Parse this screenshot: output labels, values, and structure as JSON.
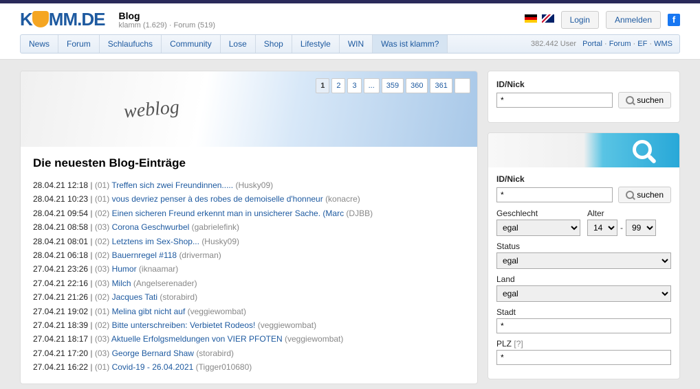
{
  "header": {
    "title": "Blog",
    "sub_site": "klamm",
    "sub_site_count": "(1.629)",
    "sub_forum": "Forum",
    "sub_forum_count": "(519)",
    "login": "Login",
    "signup": "Anmelden"
  },
  "nav": {
    "items": [
      "News",
      "Forum",
      "Schlaufuchs",
      "Community",
      "Lose",
      "Shop",
      "Lifestyle",
      "WIN",
      "Was ist klamm?"
    ],
    "active": 8,
    "usercount": "382.442 User",
    "links": [
      "Portal",
      "Forum",
      "EF",
      "WMS"
    ]
  },
  "pagination": [
    "1",
    "2",
    "3",
    "...",
    "359",
    "360",
    "361"
  ],
  "blog": {
    "heading": "Die neuesten Blog-Einträge",
    "entries": [
      {
        "ts": "28.04.21 12:18",
        "cnt": "(01)",
        "title": "Treffen sich zwei Freundinnen.....",
        "author": "(Husky09)"
      },
      {
        "ts": "28.04.21 10:23",
        "cnt": "(01)",
        "title": "vous devriez penser à des robes de demoiselle d'honneur",
        "author": "(konacre)"
      },
      {
        "ts": "28.04.21 09:54",
        "cnt": "(02)",
        "title": "Einen sicheren Freund erkennt man in unsicherer Sache. (Marc",
        "author": "(DJBB)"
      },
      {
        "ts": "28.04.21 08:58",
        "cnt": "(03)",
        "title": "Corona Geschwurbel",
        "author": "(gabrielefink)"
      },
      {
        "ts": "28.04.21 08:01",
        "cnt": "(02)",
        "title": "Letztens im Sex-Shop...",
        "author": "(Husky09)"
      },
      {
        "ts": "28.04.21 06:18",
        "cnt": "(02)",
        "title": "Bauernregel #118",
        "author": "(driverman)"
      },
      {
        "ts": "27.04.21 23:26",
        "cnt": "(03)",
        "title": "Humor",
        "author": "(iknaamar)"
      },
      {
        "ts": "27.04.21 22:16",
        "cnt": "(03)",
        "title": "Milch",
        "author": "(Angelserenader)"
      },
      {
        "ts": "27.04.21 21:26",
        "cnt": "(02)",
        "title": "Jacques Tati",
        "author": "(storabird)"
      },
      {
        "ts": "27.04.21 19:02",
        "cnt": "(01)",
        "title": "Melina gibt nicht auf",
        "author": "(veggiewombat)"
      },
      {
        "ts": "27.04.21 18:39",
        "cnt": "(02)",
        "title": "Bitte unterschreiben: Verbietet Rodeos!",
        "author": "(veggiewombat)"
      },
      {
        "ts": "27.04.21 18:17",
        "cnt": "(03)",
        "title": "Aktuelle Erfolgsmeldungen von VIER PFOTEN",
        "author": "(veggiewombat)"
      },
      {
        "ts": "27.04.21 17:20",
        "cnt": "(03)",
        "title": "George Bernard Shaw",
        "author": "(storabird)"
      },
      {
        "ts": "27.04.21 16:22",
        "cnt": "(01)",
        "title": "Covid-19 - 26.04.2021",
        "author": "(Tigger010680)"
      }
    ]
  },
  "search1": {
    "label": "ID/Nick",
    "value": "*",
    "button": "suchen"
  },
  "search2": {
    "idnick_label": "ID/Nick",
    "idnick_value": "*",
    "button": "suchen",
    "gender_label": "Geschlecht",
    "gender_value": "egal",
    "age_label": "Alter",
    "age_from": "14",
    "age_to": "99",
    "status_label": "Status",
    "status_value": "egal",
    "country_label": "Land",
    "country_value": "egal",
    "city_label": "Stadt",
    "city_value": "*",
    "plz_label": "PLZ",
    "plz_hint": "[?]",
    "plz_value": "*"
  }
}
